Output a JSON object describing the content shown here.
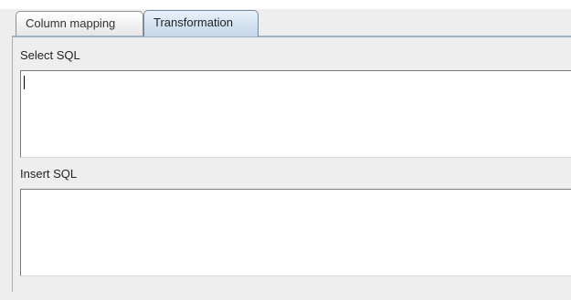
{
  "tabs": [
    {
      "label": "Column mapping",
      "selected": false
    },
    {
      "label": "Transformation",
      "selected": true
    }
  ],
  "select_sql": {
    "label": "Select SQL",
    "value": ""
  },
  "insert_sql": {
    "label": "Insert SQL",
    "value": ""
  },
  "colors": {
    "panel_background": "#eeeeee",
    "selected_tab": "#c3d6e8",
    "tab_rule": "#9db2c7"
  }
}
